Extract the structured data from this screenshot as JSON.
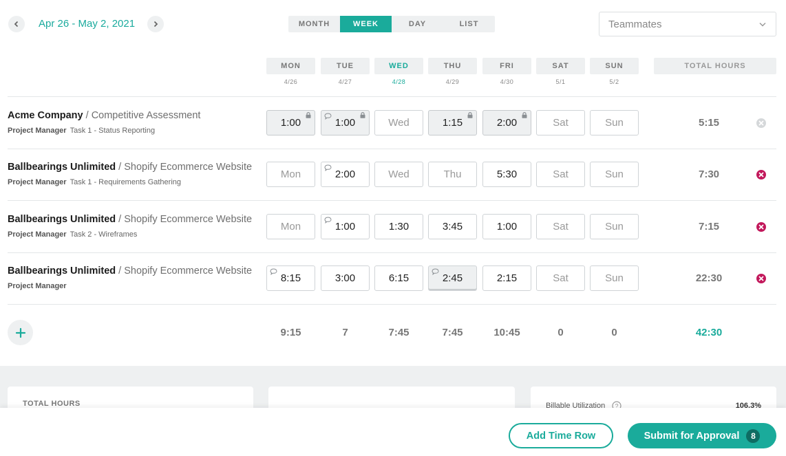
{
  "header": {
    "date_range": "Apr 26 - May 2, 2021",
    "tabs": [
      "MONTH",
      "WEEK",
      "DAY",
      "LIST"
    ],
    "active_tab": "WEEK",
    "teammates_placeholder": "Teammates"
  },
  "days": [
    {
      "label": "MON",
      "date": "4/26",
      "today": false
    },
    {
      "label": "TUE",
      "date": "4/27",
      "today": false
    },
    {
      "label": "WED",
      "date": "4/28",
      "today": true
    },
    {
      "label": "THU",
      "date": "4/29",
      "today": false
    },
    {
      "label": "FRI",
      "date": "4/30",
      "today": false
    },
    {
      "label": "SAT",
      "date": "5/1",
      "today": false
    },
    {
      "label": "SUN",
      "date": "5/2",
      "today": false
    }
  ],
  "total_hours_header": "TOTAL HOURS",
  "rows": [
    {
      "client": "Acme Company",
      "project": "Competitive Assessment",
      "role": "Project Manager",
      "task": "Task 1 - Status Reporting",
      "cells": [
        {
          "value": "1:00",
          "state": "locked",
          "comment": false
        },
        {
          "value": "1:00",
          "state": "locked",
          "comment": true
        },
        {
          "value": "Wed",
          "state": "empty",
          "comment": false
        },
        {
          "value": "1:15",
          "state": "locked",
          "comment": false
        },
        {
          "value": "2:00",
          "state": "locked",
          "comment": false
        },
        {
          "value": "Sat",
          "state": "empty",
          "comment": false
        },
        {
          "value": "Sun",
          "state": "empty",
          "comment": false
        }
      ],
      "total": "5:15",
      "removable": false
    },
    {
      "client": "Ballbearings Unlimited",
      "project": "Shopify Ecommerce Website",
      "role": "Project Manager",
      "task": "Task 1 - Requirements Gathering",
      "cells": [
        {
          "value": "Mon",
          "state": "empty",
          "comment": false
        },
        {
          "value": "2:00",
          "state": "filled",
          "comment": true
        },
        {
          "value": "Wed",
          "state": "empty",
          "comment": false
        },
        {
          "value": "Thu",
          "state": "empty",
          "comment": false
        },
        {
          "value": "5:30",
          "state": "filled",
          "comment": false
        },
        {
          "value": "Sat",
          "state": "empty",
          "comment": false
        },
        {
          "value": "Sun",
          "state": "empty",
          "comment": false
        }
      ],
      "total": "7:30",
      "removable": true
    },
    {
      "client": "Ballbearings Unlimited",
      "project": "Shopify Ecommerce Website",
      "role": "Project Manager",
      "task": "Task 2 - Wireframes",
      "cells": [
        {
          "value": "Mon",
          "state": "empty",
          "comment": false
        },
        {
          "value": "1:00",
          "state": "filled",
          "comment": true
        },
        {
          "value": "1:30",
          "state": "filled",
          "comment": false
        },
        {
          "value": "3:45",
          "state": "filled",
          "comment": false
        },
        {
          "value": "1:00",
          "state": "filled",
          "comment": false
        },
        {
          "value": "Sat",
          "state": "empty",
          "comment": false
        },
        {
          "value": "Sun",
          "state": "empty",
          "comment": false
        }
      ],
      "total": "7:15",
      "removable": true
    },
    {
      "client": "Ballbearings Unlimited",
      "project": "Shopify Ecommerce Website",
      "role": "Project Manager",
      "task": "",
      "cells": [
        {
          "value": "8:15",
          "state": "filled",
          "comment": true
        },
        {
          "value": "3:00",
          "state": "filled",
          "comment": false
        },
        {
          "value": "6:15",
          "state": "filled",
          "comment": false
        },
        {
          "value": "2:45",
          "state": "pressed",
          "comment": true
        },
        {
          "value": "2:15",
          "state": "filled",
          "comment": false
        },
        {
          "value": "Sat",
          "state": "empty",
          "comment": false
        },
        {
          "value": "Sun",
          "state": "empty",
          "comment": false
        }
      ],
      "total": "22:30",
      "removable": true
    }
  ],
  "day_totals": [
    "9:15",
    "7",
    "7:45",
    "7:45",
    "10:45",
    "0",
    "0"
  ],
  "grand_total": "42:30",
  "summary": {
    "card1_label": "TOTAL HOURS",
    "card3_label": "Billable Utilization",
    "card3_value": "106.3%"
  },
  "footer": {
    "add_row_label": "Add Time Row",
    "submit_label": "Submit for Approval",
    "submit_count": "8"
  },
  "colors": {
    "accent": "#1aab9b",
    "remove": "#c2185b"
  }
}
